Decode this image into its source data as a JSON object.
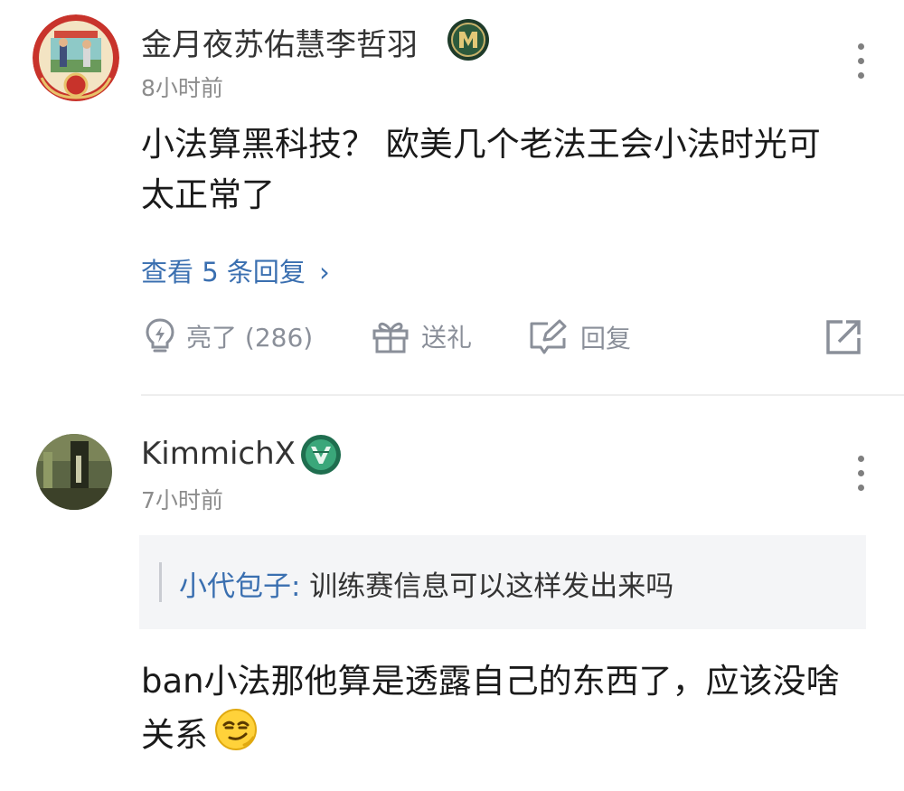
{
  "comments": [
    {
      "username": "金月夜苏佑慧李哲羽",
      "time": "8小时前",
      "content": "小法算黑科技？ 欧美几个老法王会小法时光可太正常了",
      "view_replies": "查看 5 条回复",
      "view_replies_arrow": "›",
      "badge_icon": "team-badge-icon",
      "actions": {
        "like": "亮了 (286)",
        "gift": "送礼",
        "reply": "回复"
      }
    },
    {
      "username": "KimmichX",
      "time": "7小时前",
      "badge_icon": "shield-badge-icon",
      "quote": {
        "author": "小代包子:",
        "text": " 训练赛信息可以这样发出来吗"
      },
      "content": "ban小法那他算是透露自己的东西了，应该没啥关系",
      "emoji_icon": "smirk-emoji-icon"
    }
  ],
  "colors": {
    "link": "#3a6fb0",
    "icon_gray": "#8a8f99",
    "divider": "#eeeeee",
    "quote_bg": "#f4f5f7"
  }
}
